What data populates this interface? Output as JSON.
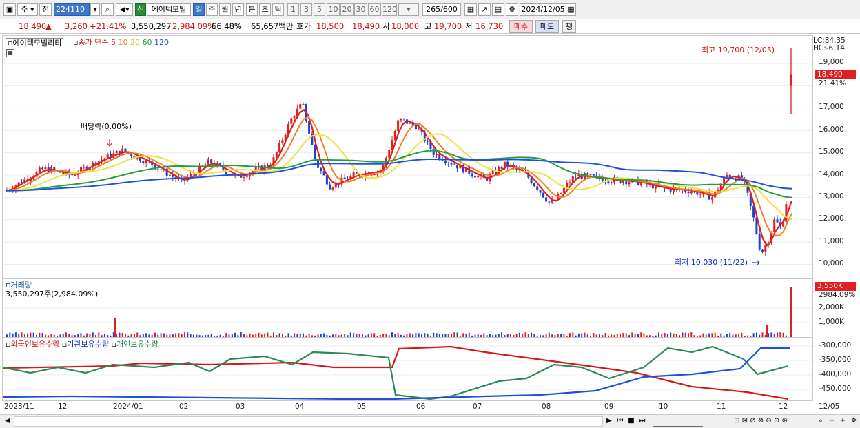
{
  "toolbar": {
    "period_d": "주",
    "prev_label": "전",
    "code": "224110",
    "sin_badge": "신",
    "stock_name": "에이텍모빌",
    "periods": [
      "일",
      "주",
      "월",
      "년",
      "분",
      "초",
      "틱"
    ],
    "minutes": [
      "1",
      "3",
      "5",
      "10",
      "20",
      "30",
      "60",
      "120"
    ],
    "count": "265",
    "count_total": "/600",
    "date": "2024/12/05"
  },
  "info": {
    "price": "18,490",
    "arrow": "▲",
    "change": "3,260",
    "change_pct": "+21.41%",
    "volume": "3,550,297",
    "volume_pct": "2,984.09%",
    "ratio": "66.48%",
    "amount": "65,657백만",
    "bid_label": "호가",
    "bid": "18,500",
    "ask": "18,490",
    "open_label": "시",
    "open": "18,000",
    "high_label": "고",
    "high": "19,700",
    "low_label": "저",
    "low": "16,730",
    "buy": "매수",
    "sell": "매도",
    "avg": "평"
  },
  "price_panel": {
    "name_tag": "에이텍모빌리티",
    "ma_label": "종가 단순",
    "ma_periods": [
      "5",
      "10",
      "20",
      "60",
      "120"
    ],
    "lc": "LC:84.35",
    "hc": "HC:-6.14",
    "high_note": "최고 19,700 (12/05)",
    "low_note": "최저 10,030 (11/22)",
    "div_note": "배당락(0.00%)",
    "y_labels": [
      "19,000",
      "17,000",
      "16,000",
      "15,000",
      "14,000",
      "13,000",
      "12,000",
      "11,000",
      "10,000"
    ],
    "price_tag": "18,490",
    "pct_tag": "21.41%"
  },
  "volume_panel": {
    "title": "거래량",
    "value": "3,550,297주(2,984.09%)",
    "y_labels": [
      "2,000K",
      "1,000K"
    ],
    "tag": "3,550K",
    "tag_pct": "2984.09%"
  },
  "holdings_panel": {
    "legend": [
      "외국인보유수량",
      "기관보유수량",
      "개인보유수량"
    ],
    "y_labels": [
      "-300,000",
      "-350,000",
      "-400,000",
      "-450,000"
    ]
  },
  "x_labels": [
    "2023/11",
    "12",
    "2024/01",
    "02",
    "03",
    "04",
    "05",
    "06",
    "07",
    "08",
    "09",
    "10",
    "11",
    "12",
    "12/05"
  ],
  "colors": {
    "ma5": "#e02020",
    "ma10": "#f08020",
    "ma20": "#f0e040",
    "ma60": "#20a040",
    "ma120": "#2050e0",
    "up": "#e02020",
    "down": "#2040d0"
  }
}
